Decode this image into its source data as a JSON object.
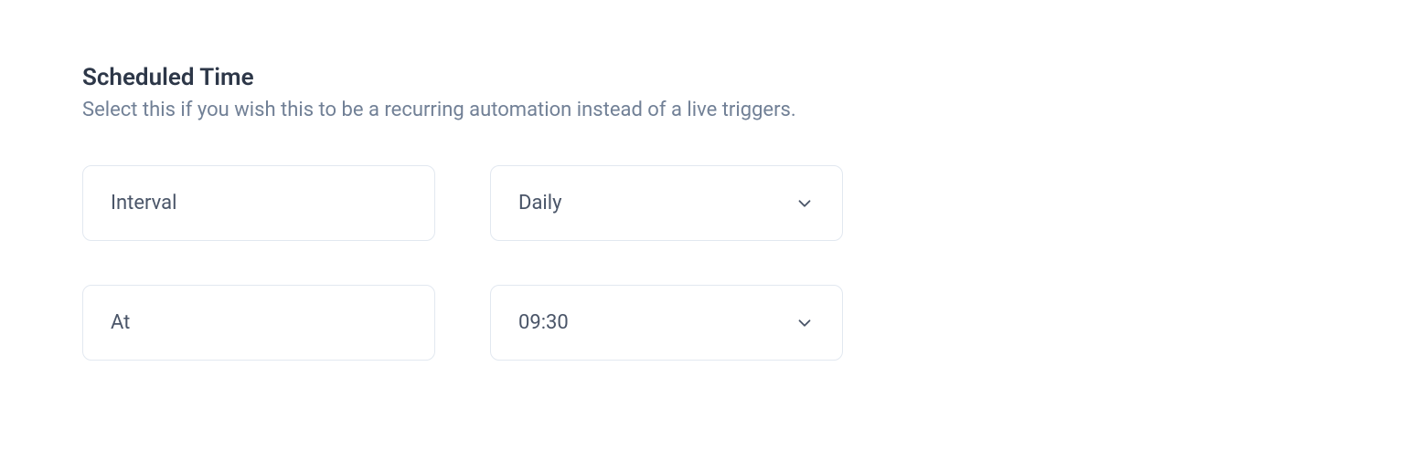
{
  "section": {
    "title": "Scheduled Time",
    "description": "Select this if you wish this to be a recurring automation instead of a live triggers."
  },
  "fields": {
    "interval": {
      "label": "Interval",
      "value": "Daily"
    },
    "at": {
      "label": "At",
      "value": "09:30"
    }
  }
}
